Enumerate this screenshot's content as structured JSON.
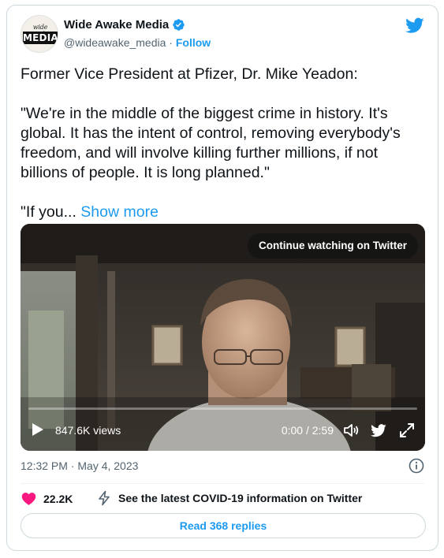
{
  "author": {
    "display_name": "Wide Awake Media",
    "handle": "@wideawake_media",
    "separator": " · ",
    "follow_label": "Follow",
    "avatar_text_top": "wide awake",
    "avatar_text_bottom": "MEDIA",
    "verified_icon": "verified-badge-icon"
  },
  "tweet": {
    "line1": "Former Vice President at Pfizer, Dr. Mike Yeadon:",
    "quote": "\"We're in the middle of the biggest crime in history. It's global. It has the intent of control, removing everybody's freedom, and will involve killing further millions, if not billions of people. It is long planned.\"",
    "truncated": "\"If you...",
    "show_more": "Show more"
  },
  "video": {
    "continue_label": "Continue watching on Twitter",
    "views": "847.6K views",
    "time": "0:00 / 2:59",
    "progress": 0.0
  },
  "meta": {
    "timestamp": "12:32 PM · May 4, 2023"
  },
  "actions": {
    "likes": "22.2K",
    "covid_info": "See the latest COVID-19 information on Twitter",
    "read_replies": "Read 368 replies"
  },
  "colors": {
    "accent": "#1d9bf0",
    "like": "#f91880",
    "text": "#0f1419",
    "muted": "#536471",
    "border": "#cfd9de"
  }
}
